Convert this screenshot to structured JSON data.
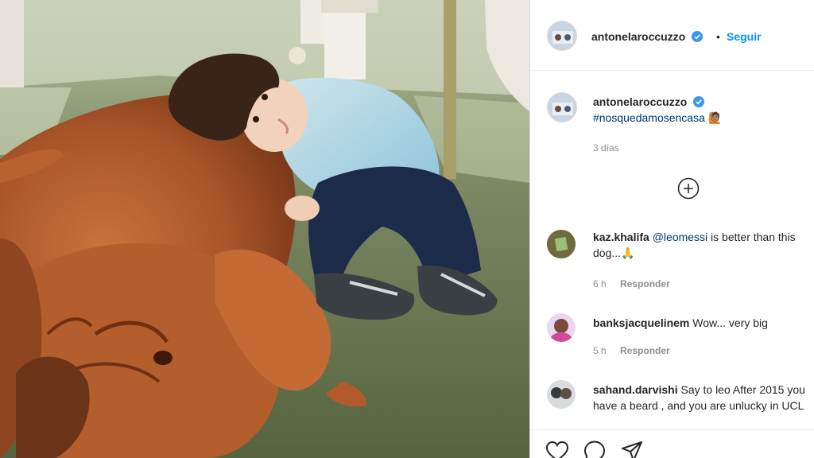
{
  "post": {
    "owner_username": "antonelaroccuzzo",
    "separator": "•",
    "follow_label": "Seguir",
    "caption_hashtag": "#nosquedamosencasa",
    "caption_emoji": "🙋🏽",
    "timestamp": "3 días"
  },
  "comments": [
    {
      "username": "kaz.khalifa",
      "mention": "@leomessi",
      "text": " is better than this dog...🙏",
      "time": "6 h",
      "reply_label": "Responder"
    },
    {
      "username": "banksjacquelinem",
      "mention": "",
      "text": "Wow... very big",
      "time": "5 h",
      "reply_label": "Responder"
    },
    {
      "username": "sahand.darvishi",
      "mention": "",
      "text": "Say to leo After 2015 you have a beard , and you are unlucky in UCL",
      "time": "",
      "reply_label": ""
    }
  ],
  "icons": {
    "verified": "verified-badge-icon",
    "load_more": "plus-circle-icon",
    "like": "heart-icon",
    "comment": "comment-bubble-icon",
    "share": "paper-plane-icon"
  },
  "colors": {
    "link_blue": "#0095f6",
    "verified_blue": "#3897f0",
    "muted": "#8e8e8e",
    "text": "#262626"
  }
}
